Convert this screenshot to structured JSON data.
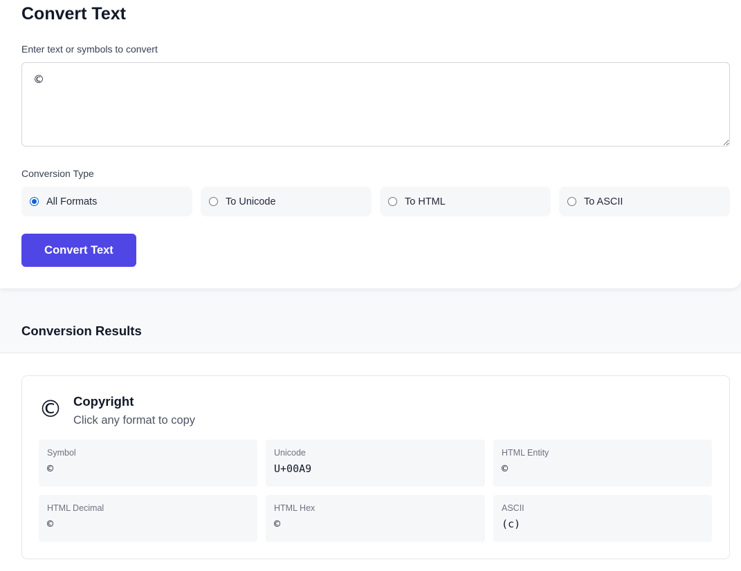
{
  "converter": {
    "title": "Convert Text",
    "input_label": "Enter text or symbols to convert",
    "input_value": "©",
    "conversion_type_label": "Conversion Type",
    "options": [
      {
        "label": "All Formats",
        "selected": true
      },
      {
        "label": "To Unicode",
        "selected": false
      },
      {
        "label": "To HTML",
        "selected": false
      },
      {
        "label": "To ASCII",
        "selected": false
      }
    ],
    "convert_button_label": "Convert Text"
  },
  "results": {
    "heading": "Conversion Results",
    "card": {
      "symbol": "©",
      "name": "Copyright",
      "hint": "Click any format to copy",
      "formats": [
        {
          "label": "Symbol",
          "value": "©"
        },
        {
          "label": "Unicode",
          "value": "U+00A9"
        },
        {
          "label": "HTML Entity",
          "value": "©"
        },
        {
          "label": "HTML Decimal",
          "value": "©"
        },
        {
          "label": "HTML Hex",
          "value": "©"
        },
        {
          "label": "ASCII",
          "value": "(c)"
        }
      ]
    }
  },
  "colors": {
    "accent": "#4f46e5",
    "radio_selected": "#0b62d6"
  }
}
